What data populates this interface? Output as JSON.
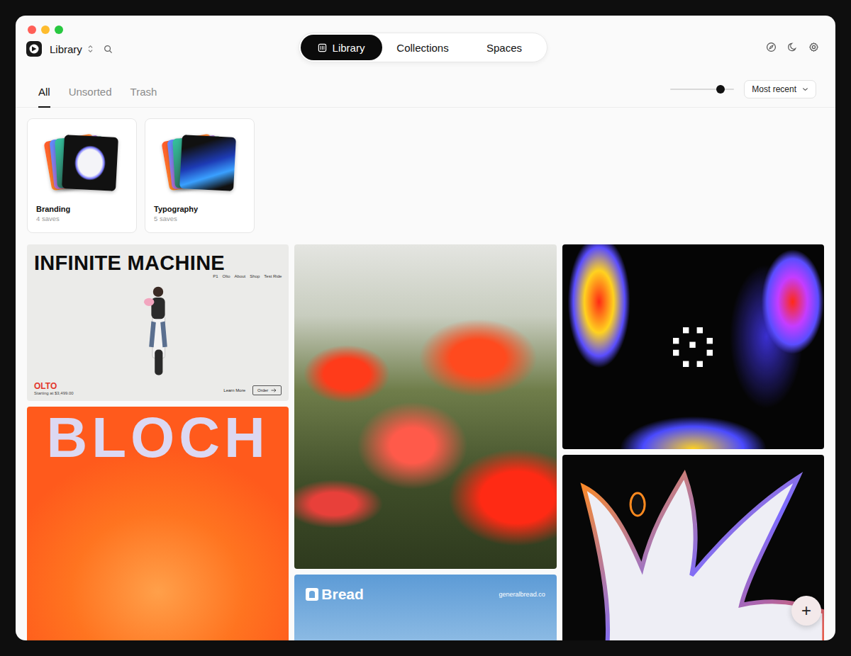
{
  "app": {
    "title": "Library"
  },
  "nav": [
    {
      "label": "Library",
      "selected": true
    },
    {
      "label": "Collections",
      "selected": false
    },
    {
      "label": "Spaces",
      "selected": false
    }
  ],
  "filters": [
    {
      "label": "All",
      "selected": true
    },
    {
      "label": "Unsorted",
      "selected": false
    },
    {
      "label": "Trash",
      "selected": false
    }
  ],
  "zoom_slider": {
    "level": 0.79
  },
  "sort": {
    "value": "Most recent"
  },
  "collections": [
    {
      "title": "Branding",
      "count": "4 saves"
    },
    {
      "title": "Typography",
      "count": "5 saves"
    }
  ],
  "gallery": {
    "columns": [
      [
        {
          "kind": "site",
          "title": "INFINITE MACHINE",
          "nav": [
            "P1",
            "Olto",
            "About",
            "Shop",
            "Test Ride"
          ],
          "brand": "OLTO",
          "price": "Starting at $3,499.00",
          "links": [
            "Learn More",
            "Order"
          ]
        },
        {
          "kind": "poster",
          "title": "BLOCH"
        }
      ],
      [
        {
          "kind": "photo"
        },
        {
          "kind": "banner",
          "title": "Bread",
          "url": "generalbread.co"
        }
      ],
      [
        {
          "kind": "thermal"
        },
        {
          "kind": "shape"
        }
      ]
    ]
  },
  "add_button": {
    "label": "+"
  }
}
